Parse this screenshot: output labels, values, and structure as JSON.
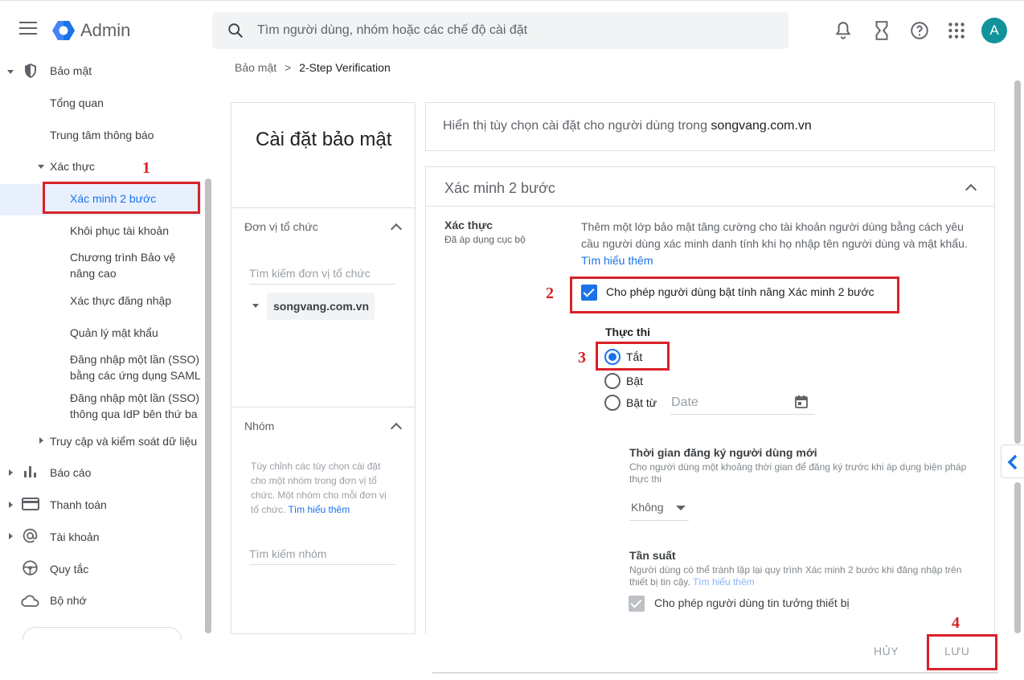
{
  "header": {
    "app_title": "Admin",
    "search_placeholder": "Tìm người dùng, nhóm hoặc các chế độ cài đặt",
    "avatar_letter": "A",
    "accent_color": "#1a73e8",
    "avatar_color": "#12939a"
  },
  "sidebar": {
    "security": "Bảo mật",
    "overview": "Tổng quan",
    "alert_center": "Trung tâm thông báo",
    "authentication": "Xác thực",
    "two_step": "Xác minh 2 bước",
    "account_recovery": "Khôi phục tài khoản",
    "advanced_protection_1": "Chương trình Bảo vệ",
    "advanced_protection_2": "nâng cao",
    "login_challenges": "Xác thực đăng nhập",
    "password_mgmt": "Quản lý mật khẩu",
    "sso_saml_1": "Đăng nhập một lần (SSO)",
    "sso_saml_2": "bằng các ứng dụng SAML",
    "sso_idp_1": "Đăng nhập một lần (SSO)",
    "sso_idp_2": "thông qua IdP bên thứ ba",
    "access_data": "Truy cập và kiểm soát dữ liệu",
    "reports": "Báo cáo",
    "billing": "Thanh toán",
    "account": "Tài khoản",
    "rules": "Quy tắc",
    "storage": "Bộ nhớ"
  },
  "breadcrumb": {
    "parent": "Bảo mật",
    "separator": ">",
    "current": "2-Step Verification"
  },
  "left_panel": {
    "title": "Cài đặt bảo mật",
    "org_units_label": "Đơn vị tổ chức",
    "org_search_placeholder": "Tìm kiếm đơn vị tổ chức",
    "org_root": "songvang.com.vn",
    "groups_label": "Nhóm",
    "groups_desc": "Tùy chỉnh các tùy chọn cài đặt cho một nhóm trong đơn vị tổ chức. Một nhóm cho mỗi đơn vị tổ chức.",
    "groups_link": "Tìm hiểu thêm",
    "group_search_placeholder": "Tìm kiếm nhóm"
  },
  "info_bar": {
    "prefix": "Hiển thị tùy chọn cài đặt cho người dùng trong",
    "domain": "songvang.com.vn"
  },
  "card": {
    "title": "Xác minh 2 bước",
    "setting_label": "Xác thực",
    "setting_sub": "Đã áp dụng cục bộ",
    "description": "Thêm một lớp bảo mật tăng cường cho tài khoản người dùng bằng cách yêu cầu người dùng xác minh danh tính khi họ nhập tên người dùng và mật khẩu.",
    "learn_more": "Tìm hiểu thêm",
    "allow_2sv_label": "Cho phép người dùng bật tính năng Xác minh 2 bước",
    "allow_2sv_checked": true,
    "enforcement_label": "Thực thi",
    "radio_off": "Tắt",
    "radio_on": "Bật",
    "radio_on_from": "Bật từ",
    "date_placeholder": "Date",
    "selected_enforcement": "Tắt",
    "enrollment_title": "Thời gian đăng ký người dùng mới",
    "enrollment_desc": "Cho người dùng một khoảng thời gian để đăng ký trước khi áp dụng biện pháp thực thi",
    "enrollment_value": "Không",
    "frequency_title": "Tần suất",
    "frequency_desc": "Người dùng có thể tránh lặp lại quy trình Xác minh 2 bước khi đăng nhập trên thiết bị tin cậy.",
    "frequency_link": "Tìm hiểu thêm",
    "trust_device_label": "Cho phép người dùng tin tưởng thiết bị"
  },
  "footer": {
    "cancel": "HỦY",
    "save": "LƯU"
  },
  "annotations": {
    "n1": "1",
    "n2": "2",
    "n3": "3",
    "n4": "4",
    "color": "#d92128"
  }
}
